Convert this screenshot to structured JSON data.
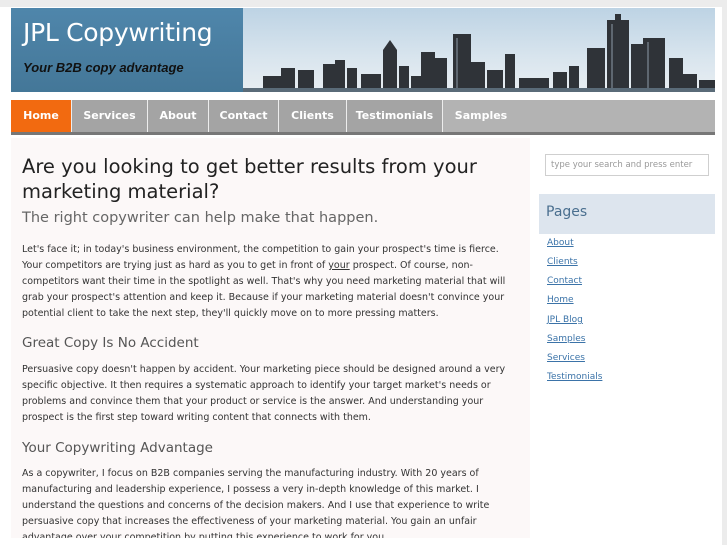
{
  "header": {
    "title": "JPL Copywriting",
    "tagline": "Your B2B copy advantage"
  },
  "nav": {
    "items": [
      {
        "label": "Home",
        "active": true
      },
      {
        "label": "Services"
      },
      {
        "label": "About"
      },
      {
        "label": "Contact"
      },
      {
        "label": "Clients"
      },
      {
        "label": "Testimonials"
      },
      {
        "label": "Samples"
      }
    ]
  },
  "main": {
    "heading": "Are you looking to get better results from your marketing material?",
    "subheading": "The right copywriter can help make that happen.",
    "intro_before": "Let's face it; in today's business environment, the competition to gain your prospect's time is fierce. Your competitors are trying just as hard as you to get in front of ",
    "intro_underlined": "your",
    "intro_after": " prospect. Of course, non-competitors want their time in the spotlight as well. That's why you need marketing material that will grab your prospect's attention and keep it. Because if your marketing material doesn't convince your potential client to take the next step, they'll quickly move on to more pressing matters.",
    "section1_heading": "Great Copy Is No Accident",
    "section1_text": "Persuasive copy doesn't happen by accident. Your marketing piece should be designed around a very specific objective. It then requires a systematic approach to identify your target market's needs or problems and convince them that your product or service is the answer. And understanding your prospect is the first step toward writing content that connects with them.",
    "section2_heading": "Your Copywriting Advantage",
    "section2_text": "As a copywriter, I focus on B2B companies serving the manufacturing industry. With 20 years of manufacturing and leadership experience, I possess a very in-depth knowledge of this market. I understand the questions and concerns of the decision makers. And I use that experience to write persuasive copy that increases the effectiveness of your marketing material. You gain an unfair advantage over your competition by putting this experience to work for you."
  },
  "sidebar": {
    "search_placeholder": "type your search and press enter",
    "pages_title": "Pages",
    "links": [
      "About",
      "Clients",
      "Contact",
      "Home",
      "JPL Blog",
      "Samples",
      "Services",
      "Testimonials"
    ]
  },
  "colors": {
    "nav_active": "#f26a10",
    "nav_bg": "#a4a4a4",
    "header_blue": "#4a7fa3",
    "link": "#3b73a8"
  }
}
